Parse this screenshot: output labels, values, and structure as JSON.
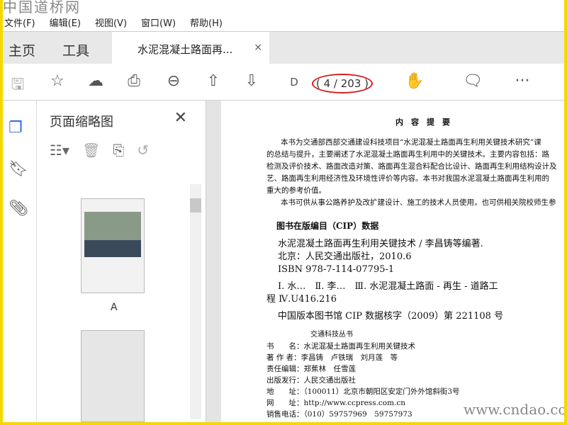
{
  "watermark_top": "中国道桥网",
  "watermark_bottom": "www.cndao.com",
  "menu": [
    "文件(F)",
    "编辑(E)",
    "视图(V)",
    "窗口(W)",
    "帮助(H)"
  ],
  "tabs": {
    "home": "主页",
    "tools": "工具",
    "document": "水泥混凝土路面再...",
    "close": "×"
  },
  "toolbar": {
    "page_indicator": "( 4 / 203 )",
    "page_label": "D"
  },
  "panel": {
    "title": "页面缩略图",
    "close": "✕",
    "thumb_label": "A"
  },
  "document": {
    "heading": "内　容　提　要",
    "abstract": [
      "本书为交通部西部交通建设科技项目“水泥混凝土路面再生利用关键技术研究”课",
      "的总结与提升，主要阐述了水泥混凝土路面再生利用中的关键技术。主要内容包括：路",
      "检测及评价技术、路面改造对策、路面再生混合料配合比设计、路面再生利用结构设计及",
      "艺、路面再生利用经济性及环境性评价等内容。本书对我国水泥混凝土路面再生利用的",
      "重大的参考价值。",
      "本书可供从事公路养护及改扩建设计、施工的技术人员使用，也可供相关院校师生参"
    ],
    "cip_title": "图书在版编目（CIP）数据",
    "cip": [
      "水泥混凝土路面再生利用关键技术 / 李昌铸等编著.",
      "北京：人民交通出版社，2010.6",
      "ISBN 978-7-114-07795-1",
      "Ⅰ. 水…　Ⅱ. 李…　Ⅲ. 水泥混凝土路面 - 再生 - 道路工",
      "程 Ⅳ.U416.216",
      "中国版本图书馆 CIP 数据核字（2009）第 221108 号"
    ],
    "series": "交通科技丛书",
    "info": [
      "书　　名：水泥混凝土路面再生利用关键技术",
      "著 作 者：李昌铸　卢铁瑞　刘月莲　等",
      "责任编辑：郑蕉林　任雪莲",
      "出版发行：人民交通出版社",
      "地　　址：（100011）北京市朝阳区安定门外外馆斜街3号",
      "网　　址：http://www.ccpress.com.cn",
      "销售电话：（010）59757969　59757973"
    ]
  }
}
